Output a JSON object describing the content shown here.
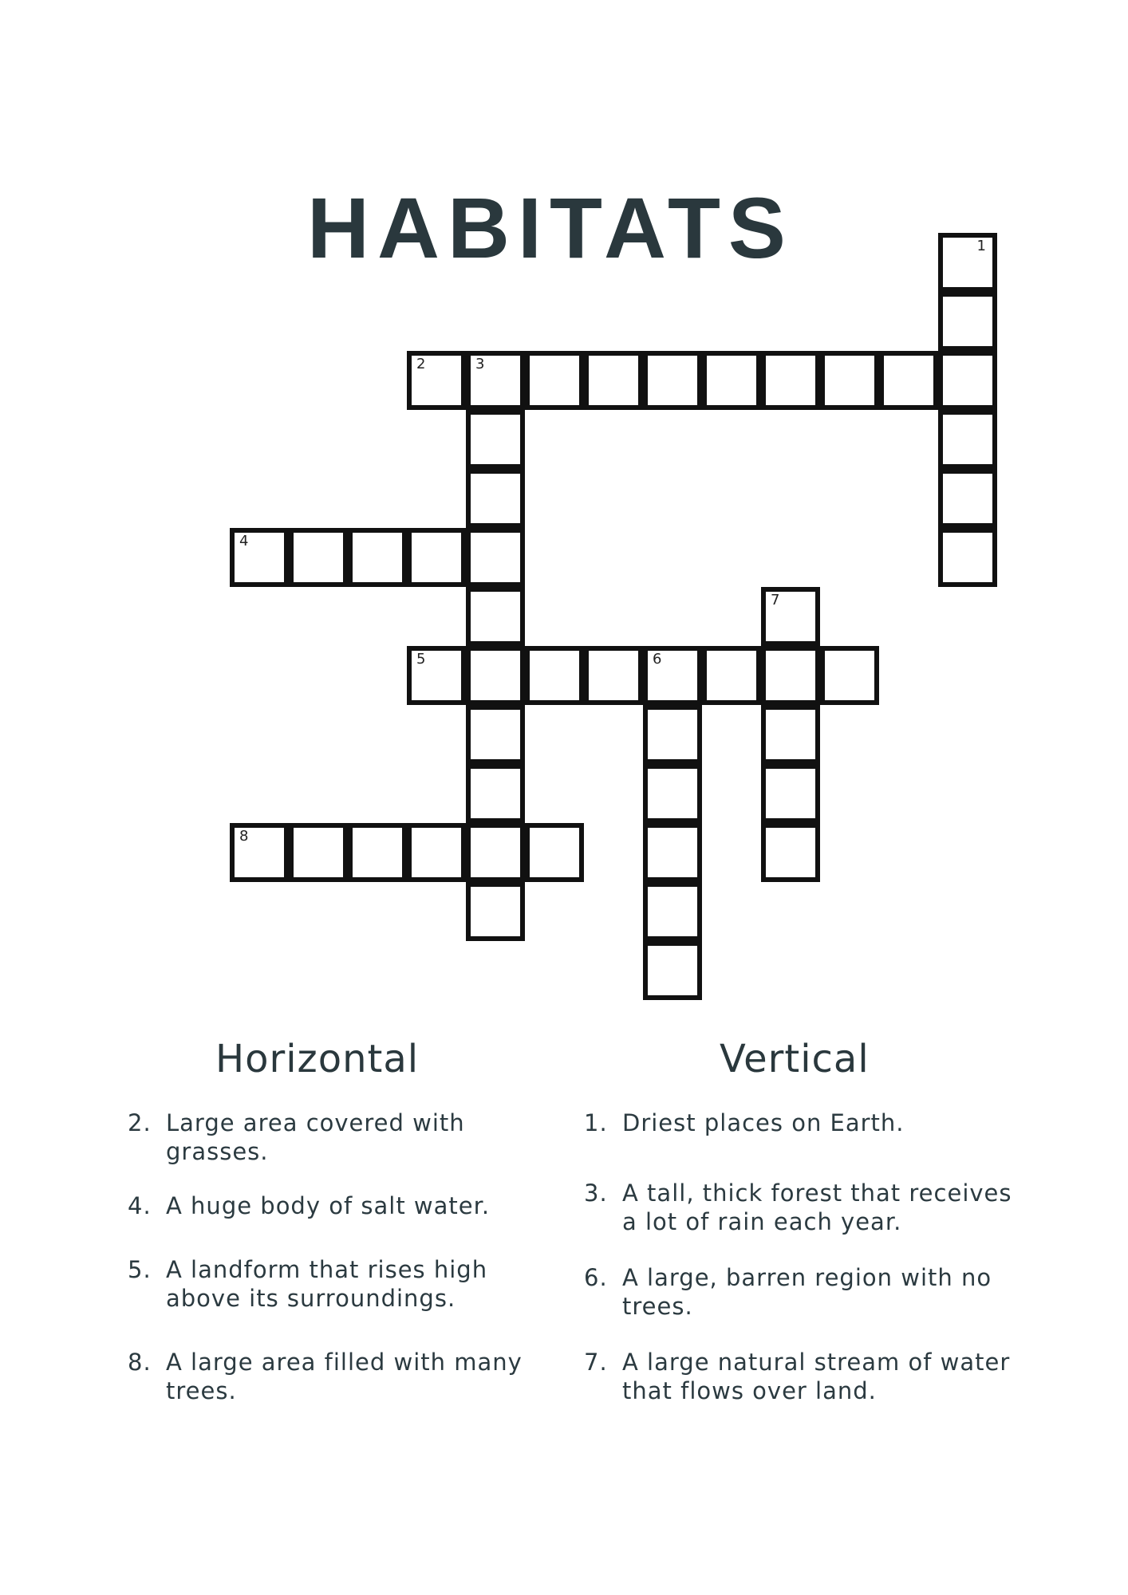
{
  "title": "HABITATS",
  "headings": {
    "across": "Horizontal",
    "down": "Vertical"
  },
  "clues": {
    "across": [
      {
        "number": "2.",
        "text": "Large area covered with grasses."
      },
      {
        "number": "4.",
        "text": "A huge body of salt water."
      },
      {
        "number": "5.",
        "text": "A landform that rises high above its surroundings."
      },
      {
        "number": "8.",
        "text": "A large area filled with many trees."
      }
    ],
    "down": [
      {
        "number": "1.",
        "text": "Driest places on Earth."
      },
      {
        "number": "3.",
        "text": "A tall, thick forest that receives a lot of rain each year."
      },
      {
        "number": "6.",
        "text": "A large, barren region with no trees."
      },
      {
        "number": "7.",
        "text": "A large natural stream of water that flows over land."
      }
    ]
  },
  "grid_numbers": [
    "1",
    "2",
    "3",
    "4",
    "5",
    "6",
    "7",
    "8"
  ]
}
